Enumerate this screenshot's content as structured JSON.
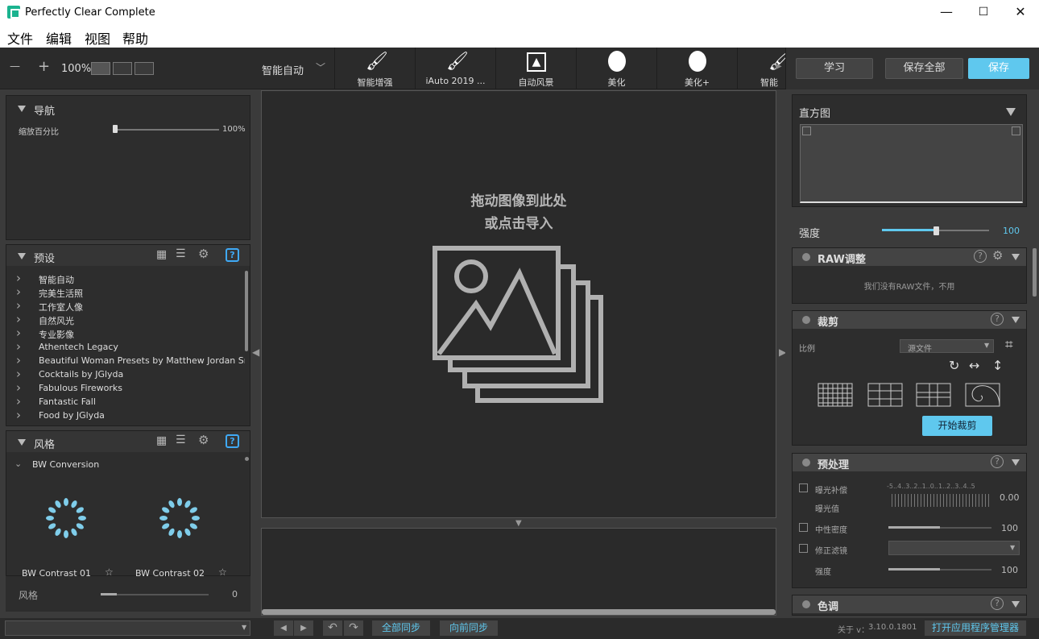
{
  "window": {
    "title": "Perfectly Clear Complete",
    "minimize": "—",
    "maximize": "☐",
    "close": "✕"
  },
  "menu": [
    "文件",
    "编辑",
    "视图",
    "帮助"
  ],
  "toolbar": {
    "zoom_minus": "—",
    "zoom_plus": "+",
    "zoom_level": "100%",
    "preset_select": "智能自动",
    "tools": [
      {
        "label": "智能增强",
        "icon": "brush-2019-icon"
      },
      {
        "label": "iAuto 2019 ...",
        "icon": "brush-eye-2019-icon"
      },
      {
        "label": "自动风景",
        "icon": "landscape-icon"
      },
      {
        "label": "美化",
        "icon": "face-icon"
      },
      {
        "label": "美化+",
        "icon": "face-plus-icon"
      },
      {
        "label": "智能",
        "icon": "brush-icon"
      }
    ],
    "learn": "学习",
    "save_all": "保存全部",
    "save": "保存"
  },
  "nav_panel": {
    "title": "导航",
    "zoom_label": "缩放百分比",
    "zoom_value": "100%",
    "zoom_fraction": 0.0
  },
  "presets_panel": {
    "title": "预设",
    "items": [
      "智能自动",
      "完美生活照",
      "工作室人像",
      "自然风光",
      "专业影像",
      "Athentech Legacy",
      "Beautiful Woman Presets by Matthew Jordan Smith",
      "Cocktails by JGlyda",
      "Fabulous Fireworks",
      "Fantastic Fall",
      "Food by JGlyda"
    ]
  },
  "style_panel": {
    "title": "风格",
    "group": "BW Conversion",
    "thumbs": [
      "BW Contrast 01",
      "BW Contrast 02"
    ],
    "footer_label": "风格",
    "footer_value": "0",
    "footer_fraction": 0.15
  },
  "canvas": {
    "drop_line1": "拖动图像到此处",
    "drop_line2": "或点击导入"
  },
  "right": {
    "histogram_title": "直方图",
    "strength_label": "强度",
    "strength_value": "100",
    "strength_fraction": 0.5,
    "raw": {
      "title": "RAW调整",
      "message": "我们没有RAW文件，不用"
    },
    "crop": {
      "title": "裁剪",
      "ratio_label": "比例",
      "ratio_value": "源文件",
      "start": "开始裁剪"
    },
    "pre": {
      "title": "预处理",
      "exposure_label": "曝光补偿",
      "exposure_sub": "曝光值",
      "exposure_scale": "-5..4..3..2..1..0..1..2..3..4..5",
      "exposure_value": "0.00",
      "neutral_label": "中性密度",
      "neutral_value": "100",
      "neutral_fraction": 0.5,
      "filter_label": "修正滤镜",
      "strength_label": "强度",
      "strength_value": "100",
      "strength_fraction": 0.5
    },
    "tone": {
      "title": "色调"
    }
  },
  "status": {
    "prev": "◀",
    "next": "▶",
    "undo": "↶",
    "redo": "↷",
    "sync_all": "全部同步",
    "sync_forward": "向前同步",
    "version_label": "关于 v：",
    "version": "3.10.0.1801",
    "app_manager": "打开应用程序管理器"
  },
  "colors": {
    "accent": "#5fc8ee",
    "help": "#3fa9f5",
    "bg": "#2b2b2b"
  }
}
